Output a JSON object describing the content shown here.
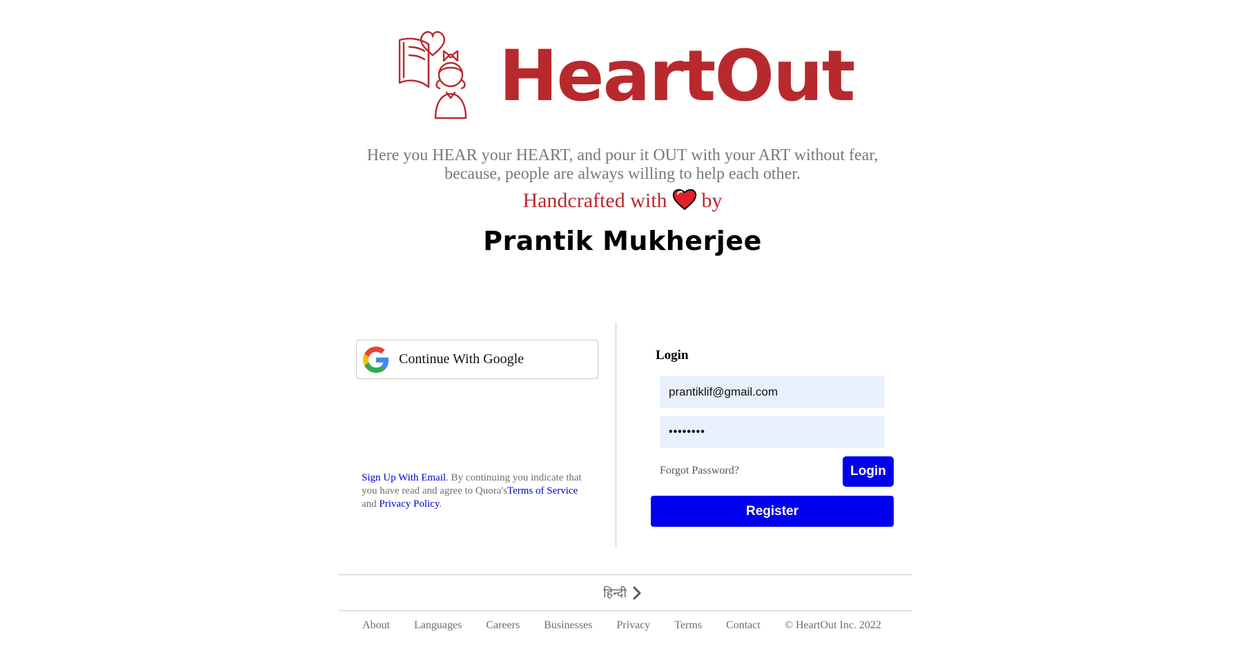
{
  "brand": {
    "name": "HeartOut",
    "color": "#b8292d"
  },
  "hero": {
    "tagline_line1": "Here you HEAR your HEART, and pour it OUT with your ART without fear,",
    "tagline_line2": "because, people are always willing to help each other.",
    "handcrafted_prefix": "Handcrafted with",
    "handcrafted_suffix": "by",
    "author": "Prantik Mukherjee"
  },
  "social": {
    "google_label": "Continue With Google"
  },
  "signup_note": {
    "signup_link": "Sign Up With Email",
    "text_mid": ". By continuing you indicate that you have read and agree to Quora's",
    "terms_link": "Terms of Service",
    "text_and": " and ",
    "privacy_link": "Privacy Policy",
    "text_end": "."
  },
  "login": {
    "heading": "Login",
    "email_value": "prantiklif@gmail.com",
    "password_mask": "••••••••",
    "forgot_label": "Forgot Password?",
    "login_label": "Login",
    "register_label": "Register",
    "accent": "#0000ee"
  },
  "language": {
    "label": "हिन्दी"
  },
  "footer": {
    "links": [
      "About",
      "Languages",
      "Careers",
      "Businesses",
      "Privacy",
      "Terms",
      "Contact"
    ],
    "copyright": "© HeartOut Inc. 2022"
  }
}
